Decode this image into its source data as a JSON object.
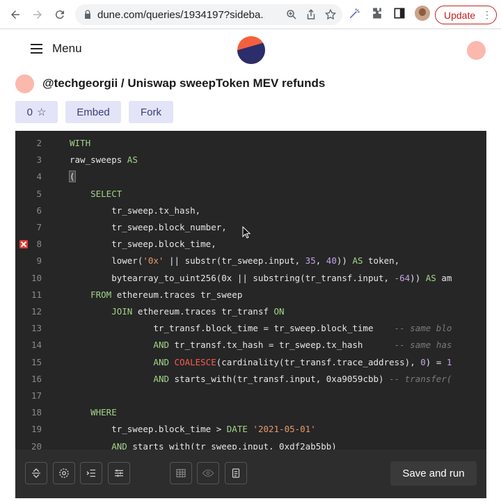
{
  "browser": {
    "url": "dune.com/queries/1934197?sideba...",
    "update_label": "Update"
  },
  "header": {
    "menu_label": "Menu"
  },
  "query": {
    "title": "@techgeorgii / Uniswap sweepToken MEV refunds",
    "star_count": "0",
    "embed_label": "Embed",
    "fork_label": "Fork"
  },
  "editor": {
    "lines": [
      {
        "no": "2",
        "error": false,
        "html": "<span class=\"kw\">WITH</span>"
      },
      {
        "no": "3",
        "error": false,
        "html": "raw_sweeps <span class=\"kw\">AS</span>"
      },
      {
        "no": "4",
        "error": false,
        "html": "<span class=\"cursor-paren\">(</span>"
      },
      {
        "no": "5",
        "error": false,
        "html": "    <span class=\"kw\">SELECT</span>"
      },
      {
        "no": "6",
        "error": false,
        "html": "        tr_sweep.tx_hash,"
      },
      {
        "no": "7",
        "error": false,
        "html": "        tr_sweep.block_number,"
      },
      {
        "no": "8",
        "error": true,
        "html": "        tr_sweep.block_time,"
      },
      {
        "no": "9",
        "error": false,
        "html": "        lower(<span class=\"str\">'0x'</span> || substr(tr_sweep.input, <span class=\"num\">35</span>, <span class=\"num\">40</span>)) <span class=\"kw\">AS</span> token,"
      },
      {
        "no": "10",
        "error": false,
        "html": "        bytearray_to_uint256(0x || substring(tr_transf.input, <span class=\"num\">-64</span>)) <span class=\"kw\">AS</span> am"
      },
      {
        "no": "11",
        "error": false,
        "html": "    <span class=\"kw\">FROM</span> ethereum.traces tr_sweep"
      },
      {
        "no": "12",
        "error": false,
        "html": "        <span class=\"kw\">JOIN</span> ethereum.traces tr_transf <span class=\"kw\">ON</span>"
      },
      {
        "no": "13",
        "error": false,
        "html": "                tr_transf.block_time = tr_sweep.block_time    <span class=\"cmt\">-- same blo</span>"
      },
      {
        "no": "14",
        "error": false,
        "html": "                <span class=\"kw\">AND</span> tr_transf.tx_hash = tr_sweep.tx_hash      <span class=\"cmt\">-- same has</span>"
      },
      {
        "no": "15",
        "error": false,
        "html": "                <span class=\"kw\">AND</span> <span class=\"red\">COALESCE</span>(cardinality(tr_transf.trace_address), <span class=\"num\">0</span>) = <span class=\"num\">1</span>"
      },
      {
        "no": "16",
        "error": false,
        "html": "                <span class=\"kw\">AND</span> starts_with(tr_transf.input, 0xa9059cbb) <span class=\"cmt\">-- transfer(</span>"
      },
      {
        "no": "17",
        "error": false,
        "html": ""
      },
      {
        "no": "18",
        "error": false,
        "html": "    <span class=\"kw\">WHERE</span>"
      },
      {
        "no": "19",
        "error": false,
        "html": "        tr_sweep.block_time > <span class=\"kw\">DATE</span> <span class=\"str\">'2021-05-01'</span>"
      },
      {
        "no": "20",
        "error": false,
        "html": "        <span class=\"kw\">AND</span> starts_with(tr_sweep.input, 0xdf2ab5bb)"
      }
    ]
  },
  "toolbar": {
    "save_label": "Save and run"
  }
}
